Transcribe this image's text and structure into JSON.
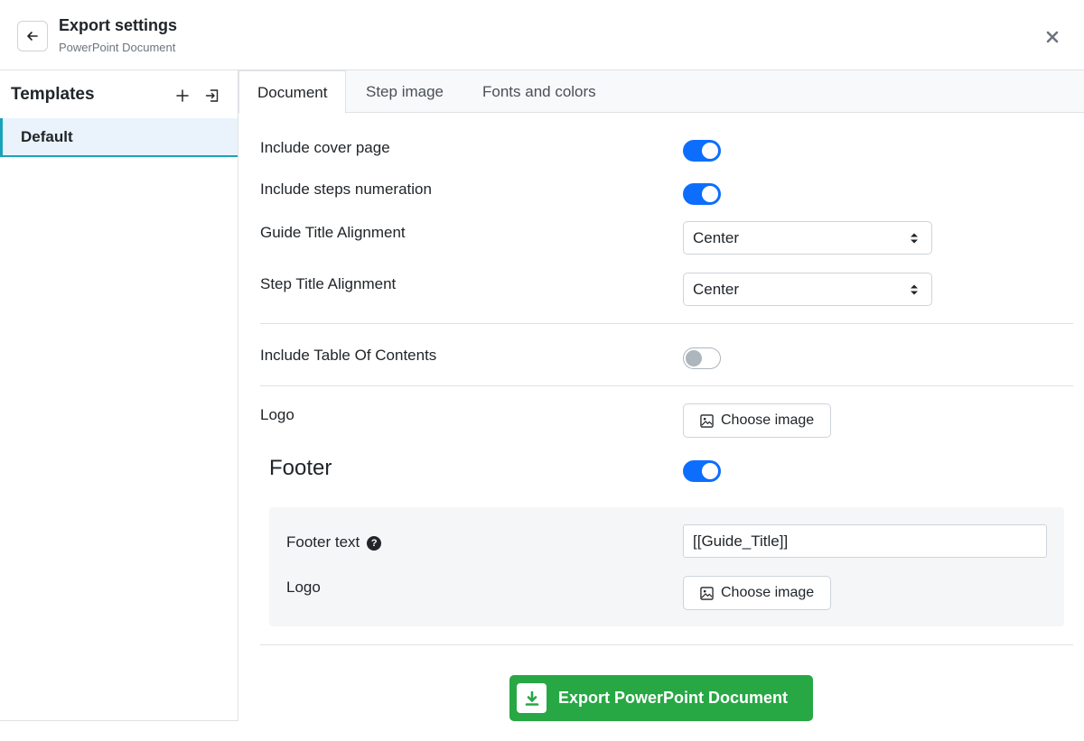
{
  "header": {
    "title": "Export settings",
    "subtitle": "PowerPoint Document"
  },
  "sidebar": {
    "title": "Templates",
    "items": [
      {
        "label": "Default",
        "selected": true
      }
    ]
  },
  "tabs": [
    {
      "label": "Document",
      "active": true
    },
    {
      "label": "Step image",
      "active": false
    },
    {
      "label": "Fonts and colors",
      "active": false
    }
  ],
  "document": {
    "cover_page": {
      "label": "Include cover page",
      "enabled": true
    },
    "steps_numeration": {
      "label": "Include steps numeration",
      "enabled": true
    },
    "guide_title_alignment": {
      "label": "Guide Title Alignment",
      "value": "Center"
    },
    "step_title_alignment": {
      "label": "Step Title Alignment",
      "value": "Center"
    },
    "table_of_contents": {
      "label": "Include Table Of Contents",
      "enabled": false
    },
    "logo": {
      "label": "Logo",
      "button_label": "Choose image"
    }
  },
  "footer": {
    "heading": "Footer",
    "enabled": true,
    "text_label": "Footer text",
    "help_glyph": "?",
    "text_value": "[[Guide_Title]]",
    "logo_label": "Logo",
    "logo_button_label": "Choose image"
  },
  "export_button": {
    "label": "Export PowerPoint Document"
  },
  "colors": {
    "toggle_on": "#0d6efd",
    "export_green": "#28a745",
    "selected_accent": "#17a2b8"
  }
}
